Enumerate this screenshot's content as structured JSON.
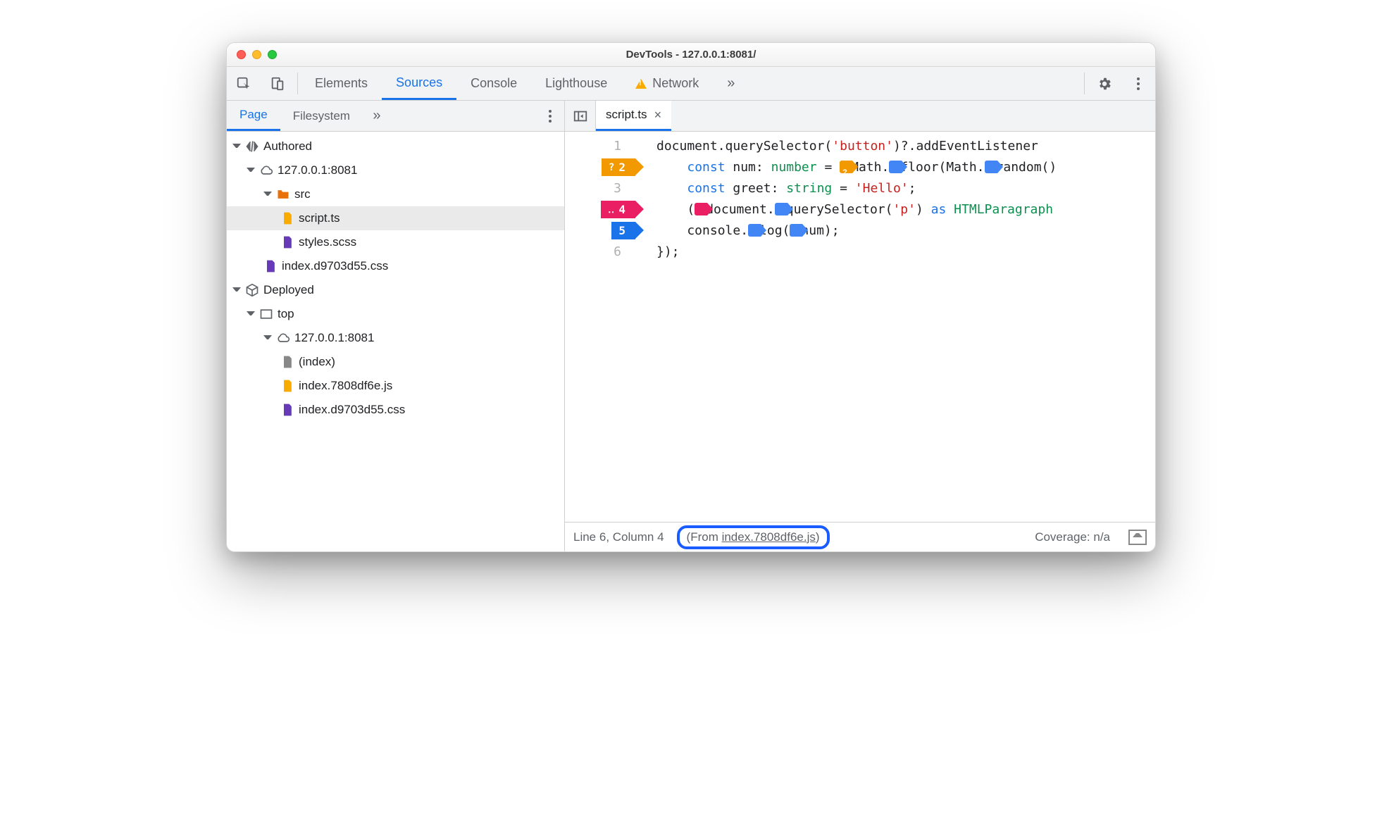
{
  "window": {
    "title": "DevTools - 127.0.0.1:8081/"
  },
  "tabs": {
    "elements": "Elements",
    "sources": "Sources",
    "console": "Console",
    "lighthouse": "Lighthouse",
    "network": "Network",
    "more": "»"
  },
  "sidebar": {
    "tabs": {
      "page": "Page",
      "filesystem": "Filesystem",
      "more": "»"
    },
    "tree": {
      "authored": "Authored",
      "host1": "127.0.0.1:8081",
      "src": "src",
      "script": "script.ts",
      "styles": "styles.scss",
      "indexcss": "index.d9703d55.css",
      "deployed": "Deployed",
      "top": "top",
      "host2": "127.0.0.1:8081",
      "index": "(index)",
      "indexjs": "index.7808df6e.js",
      "indexcss2": "index.d9703d55.css"
    }
  },
  "editor": {
    "filename": "script.ts",
    "lines": {
      "n1": "1",
      "n2": "2",
      "n3": "3",
      "n4": "4",
      "n5": "5",
      "n6": "6"
    },
    "bp2": "?",
    "bp4": "‥",
    "code": {
      "l1a": "document",
      "l1b": ".querySelector(",
      "l1c": "'button'",
      "l1d": ")?.addEventListener",
      "l2a": "    ",
      "l2b": "const",
      "l2c": " num: ",
      "l2d": "number",
      "l2e": " = ",
      "l2f": "Math.",
      "l2g": "floor(Math.",
      "l2h": "random()",
      "l3a": "    ",
      "l3b": "const",
      "l3c": " greet: ",
      "l3d": "string",
      "l3e": " = ",
      "l3f": "'Hello'",
      "l3g": ";",
      "l4a": "    (",
      "l4b": "document.",
      "l4c": "querySelector(",
      "l4d": "'p'",
      "l4e": ") ",
      "l4f": "as",
      "l4g": " HTMLParagraph",
      "l5a": "    console.",
      "l5b": "log(",
      "l5c": "num);",
      "l6": "});"
    }
  },
  "status": {
    "cursor": "Line 6, Column 4",
    "from_prefix": "(From ",
    "from_link": "index.7808df6e.js",
    "from_suffix": ")",
    "coverage": "Coverage: n/a"
  }
}
